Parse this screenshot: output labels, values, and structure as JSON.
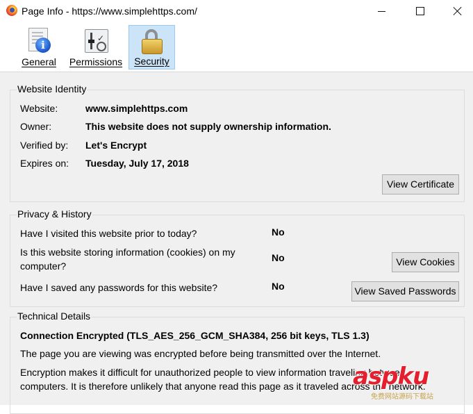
{
  "window": {
    "title": "Page Info - https://www.simplehttps.com/"
  },
  "toolbar": {
    "tabs": [
      {
        "label": "General",
        "icon": "info-document-icon"
      },
      {
        "label": "Permissions",
        "icon": "permissions-sliders-icon"
      },
      {
        "label": "Security",
        "icon": "padlock-icon",
        "selected": true
      }
    ]
  },
  "identity": {
    "title": "Website Identity",
    "rows": [
      {
        "label": "Website:",
        "value": "www.simplehttps.com"
      },
      {
        "label": "Owner:",
        "value": "This website does not supply ownership information."
      },
      {
        "label": "Verified by:",
        "value": "Let's Encrypt"
      },
      {
        "label": "Expires on:",
        "value": "Tuesday, July 17, 2018"
      }
    ],
    "view_certificate": "View Certificate"
  },
  "privacy": {
    "title": "Privacy & History",
    "rows": [
      {
        "question": "Have I visited this website prior to today?",
        "answer": "No"
      },
      {
        "question": "Is this website storing information (cookies) on my computer?",
        "answer": "No"
      },
      {
        "question": "Have I saved any passwords for this website?",
        "answer": "No"
      }
    ],
    "view_cookies": "View Cookies",
    "view_saved_passwords": "View Saved Passwords"
  },
  "technical": {
    "title": "Technical Details",
    "headline": "Connection Encrypted (TLS_AES_256_GCM_SHA384, 256 bit keys, TLS 1.3)",
    "line1": "The page you are viewing was encrypted before being transmitted over the Internet.",
    "line2": "Encryption makes it difficult for unauthorized people to view information traveling between",
    "line3": "computers. It is therefore unlikely that anyone read this page as it traveled across the network."
  },
  "watermark": {
    "main": "aspku",
    "sub": "免费网站源码下载站"
  },
  "colors": {
    "selected_tab_bg": "#cce4f7",
    "panel_bg": "#f0f0f0",
    "button_bg": "#e1e1e1",
    "watermark_red": "#e4202e"
  }
}
